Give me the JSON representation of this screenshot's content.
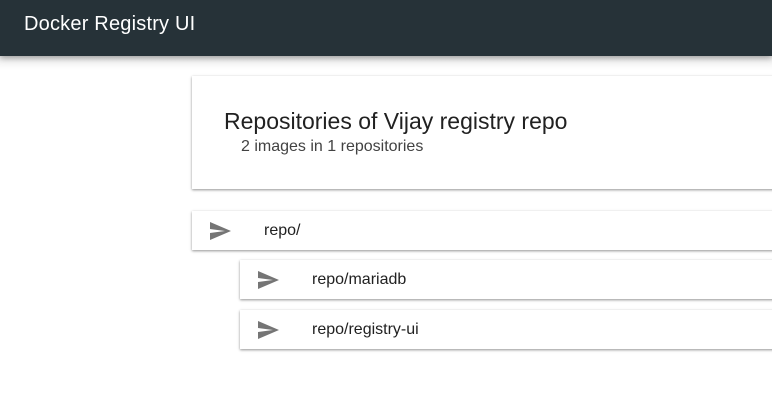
{
  "app_bar": {
    "title": "Docker Registry UI"
  },
  "header": {
    "title": "Repositories of Vijay registry repo",
    "subtitle": "2 images in 1 repositories"
  },
  "repositories": [
    {
      "label": "repo/",
      "icon": "send-icon"
    },
    {
      "label": "repo/mariadb",
      "icon": "send-icon"
    },
    {
      "label": "repo/registry-ui",
      "icon": "send-icon"
    }
  ],
  "colors": {
    "app_bar": "#263238",
    "icon": "#757575"
  }
}
